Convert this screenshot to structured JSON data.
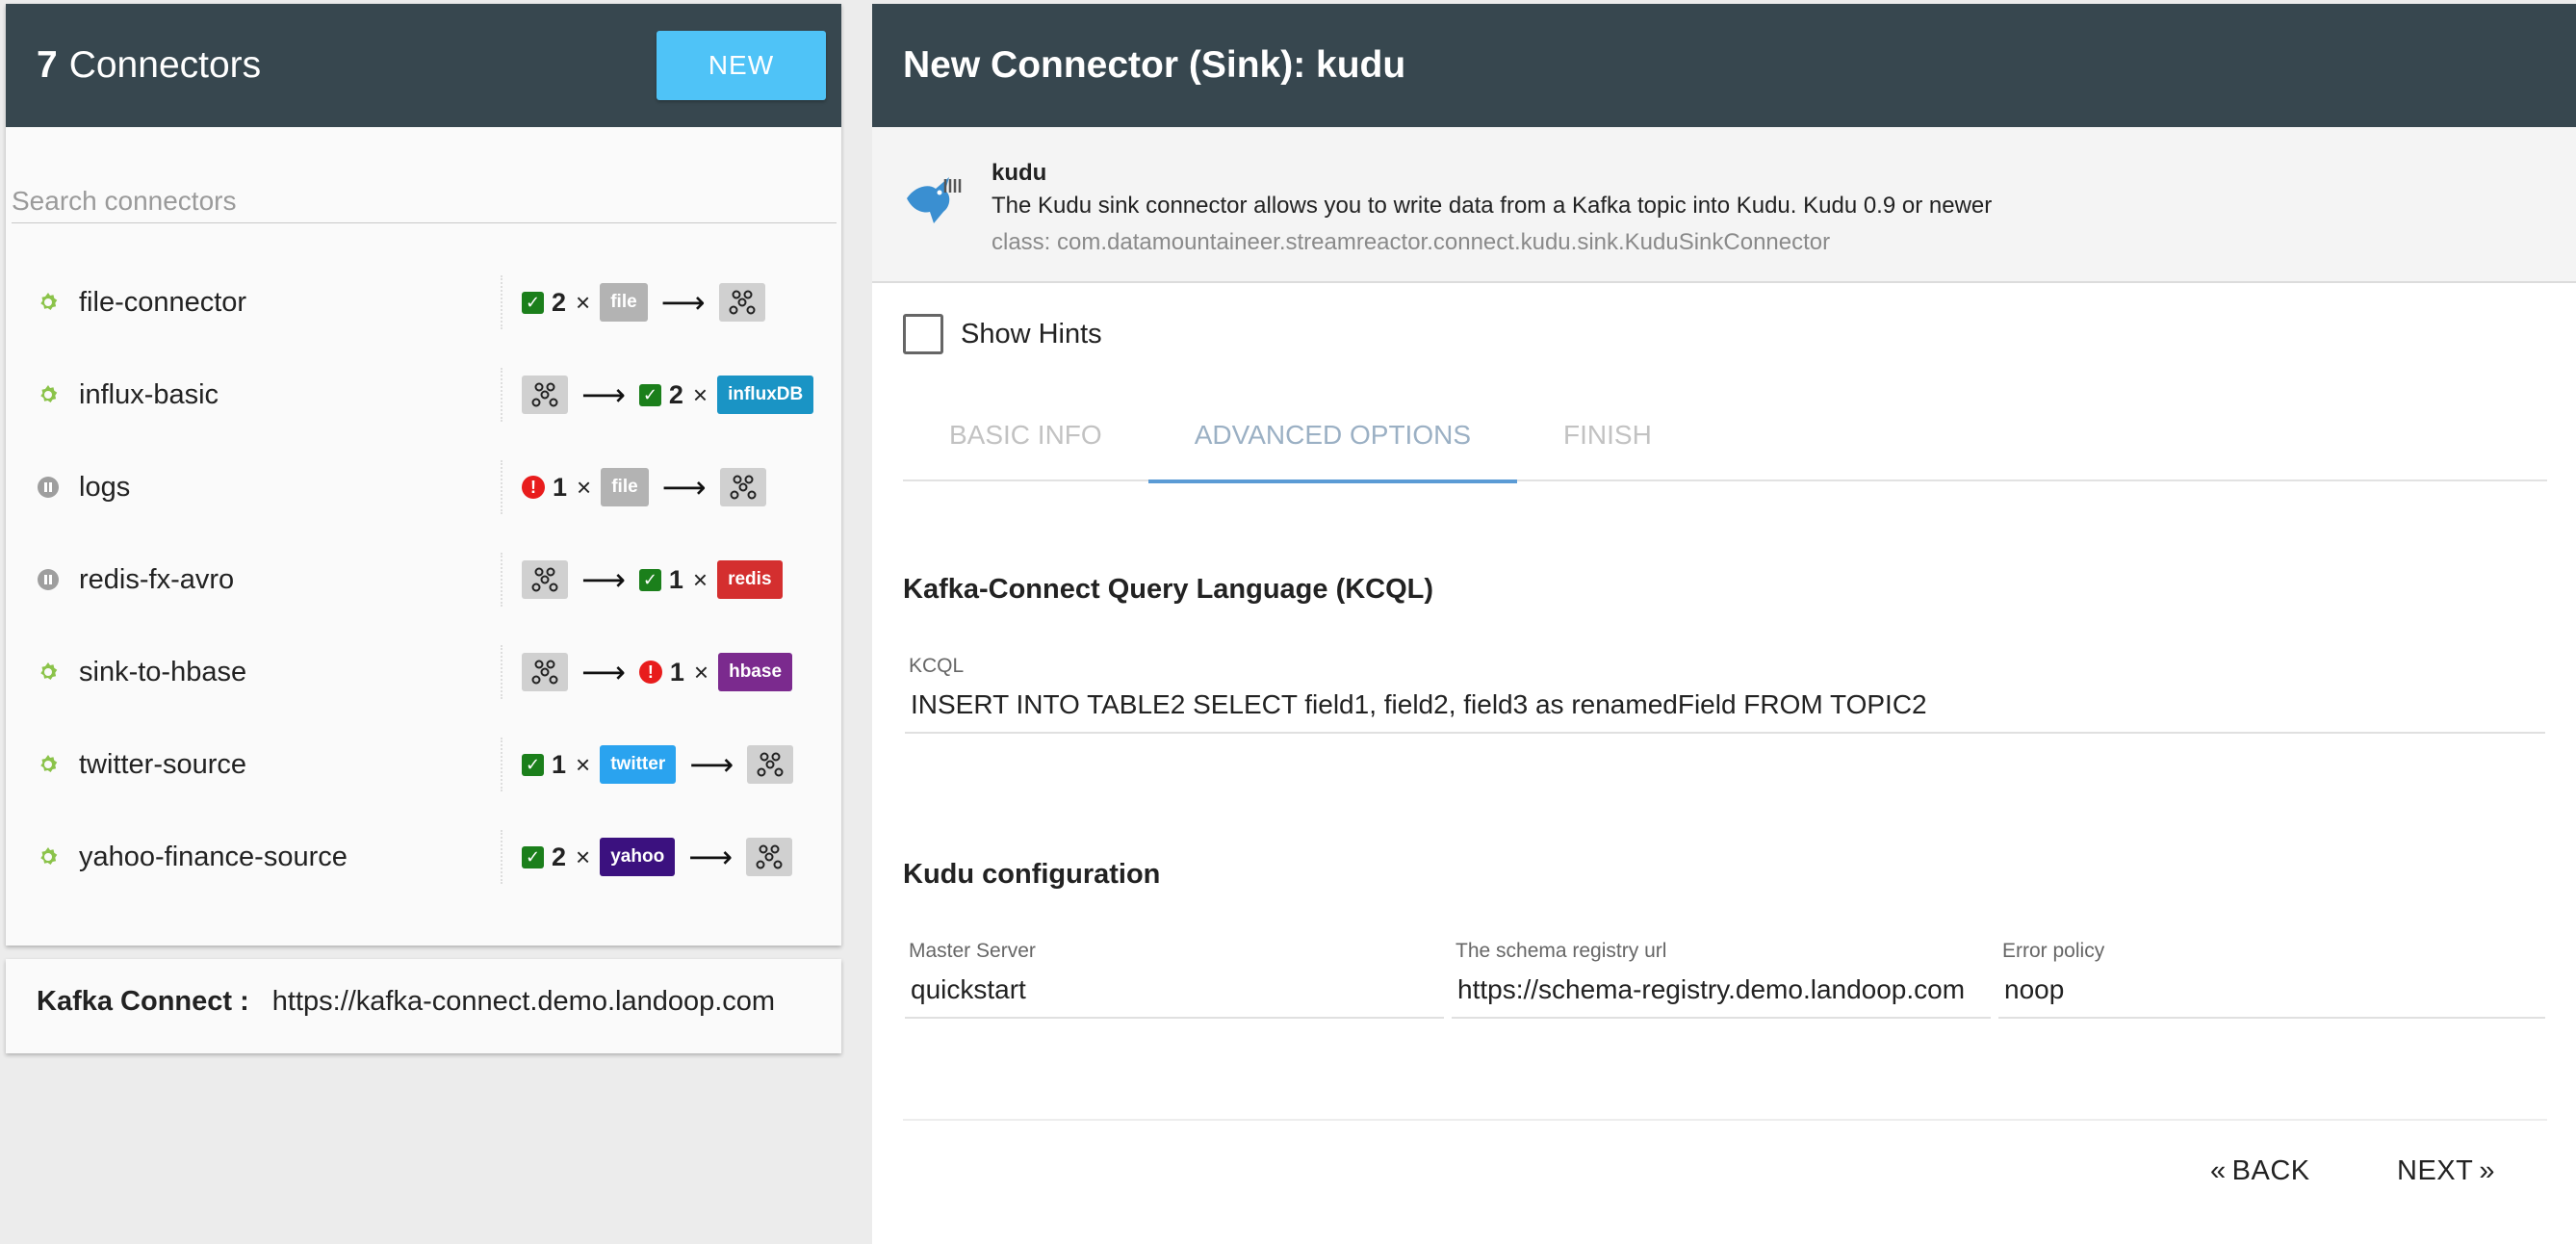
{
  "left": {
    "count": "7",
    "title": "Connectors",
    "new_label": "NEW",
    "search_placeholder": "Search connectors",
    "connectors": [
      {
        "name": "file-connector",
        "status": "running"
      },
      {
        "name": "influx-basic",
        "status": "running"
      },
      {
        "name": "logs",
        "status": "paused"
      },
      {
        "name": "redis-fx-avro",
        "status": "paused"
      },
      {
        "name": "sink-to-hbase",
        "status": "running"
      },
      {
        "name": "twitter-source",
        "status": "running"
      },
      {
        "name": "yahoo-finance-source",
        "status": "running"
      }
    ],
    "flows": {
      "r0": {
        "count": "2",
        "x": "×",
        "badge": "file"
      },
      "r1": {
        "count": "2",
        "x": "×",
        "badge": "influxDB"
      },
      "r2": {
        "count": "1",
        "x": "×",
        "badge": "file"
      },
      "r3": {
        "count": "1",
        "x": "×",
        "badge": "redis"
      },
      "r4": {
        "count": "1",
        "x": "×",
        "badge": "hbase"
      },
      "r5": {
        "count": "1",
        "x": "×",
        "badge": "twitter"
      },
      "r6": {
        "count": "2",
        "x": "×",
        "badge": "yahoo"
      }
    },
    "arrow": "⟶",
    "footer_label": "Kafka Connect :",
    "footer_url": "https://kafka-connect.demo.landoop.com"
  },
  "colors": {
    "header": "#37474f",
    "new_button": "#4fc3f7",
    "running": "#8bc34a",
    "paused": "#9e9e9e",
    "success": "#1b7f1b",
    "error": "#e81c1c",
    "file": "#b3b3b3",
    "influxDB": "#1a94c5",
    "redis": "#d42f2f",
    "hbase": "#7b2a8e",
    "twitter": "#2aa3ef",
    "yahoo": "#3b117f",
    "tab_active": "#5b9bd5"
  },
  "right": {
    "title": "New Connector (Sink): kudu",
    "plugin_name": "kudu",
    "plugin_desc": "The Kudu sink connector allows you to write data from a Kafka topic into Kudu. Kudu 0.9 or newer",
    "plugin_class": "class: com.datamountaineer.streamreactor.connect.kudu.sink.KuduSinkConnector",
    "show_hints": "Show Hints",
    "tabs": [
      "BASIC INFO",
      "ADVANCED OPTIONS",
      "FINISH"
    ],
    "active_tab": "ADVANCED OPTIONS",
    "kcql_section": "Kafka-Connect Query Language (KCQL)",
    "kcql_label": "KCQL",
    "kcql_value": "INSERT INTO TABLE2 SELECT field1, field2, field3 as renamedField FROM TOPIC2",
    "kudu_section": "Kudu configuration",
    "master_label": "Master Server",
    "master_value": "quickstart",
    "schema_label": "The schema registry url",
    "schema_value": "https://schema-registry.demo.landoop.com",
    "error_label": "Error policy",
    "error_value": "noop",
    "back_label": "BACK",
    "next_label": "NEXT"
  }
}
